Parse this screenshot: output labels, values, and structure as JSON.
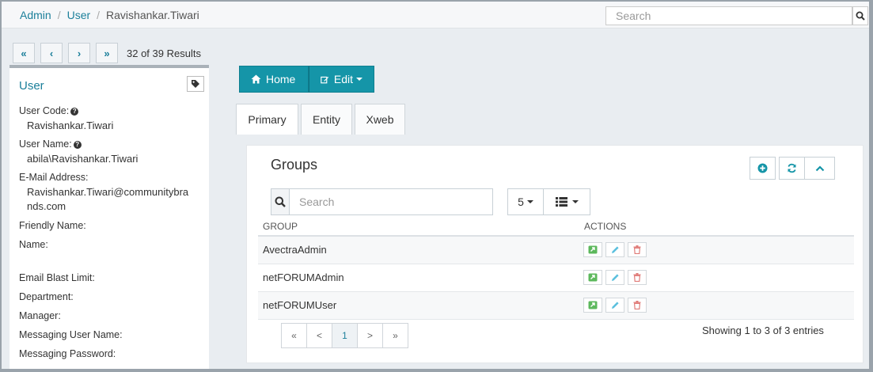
{
  "breadcrumb": [
    "Admin",
    "User",
    "Ravishankar.Tiwari"
  ],
  "top_search": {
    "placeholder": "Search"
  },
  "pager": {
    "first": "«",
    "prev": "‹",
    "next": "›",
    "last": "»",
    "results": "32 of 39 Results"
  },
  "sidebar": {
    "title": "User",
    "fields": {
      "user_code_label": "User Code:",
      "user_code_value": "Ravishankar.Tiwari",
      "user_name_label": "User Name:",
      "user_name_value": "abila\\Ravishankar.Tiwari",
      "email_label": "E-Mail Address:",
      "email_value_1": "Ravishankar.Tiwari@communitybra",
      "email_value_2": "nds.com",
      "friendly_name_label": "Friendly Name:",
      "name_label": "Name:",
      "email_blast_label": "Email Blast Limit:",
      "department_label": "Department:",
      "manager_label": "Manager:",
      "messaging_user_label": "Messaging User Name:",
      "messaging_password_label": "Messaging Password:"
    }
  },
  "toolbar": {
    "home_label": "Home",
    "edit_label": "Edit"
  },
  "tabs": [
    "Primary",
    "Entity",
    "Xweb"
  ],
  "groups_panel": {
    "title": "Groups",
    "search_placeholder": "Search",
    "page_size": "5",
    "columns": [
      "GROUP",
      "ACTIONS"
    ],
    "rows": [
      "AvectraAdmin",
      "netFORUMAdmin",
      "netFORUMUser"
    ],
    "pagination": [
      "«",
      "<",
      "1",
      ">",
      "»"
    ],
    "showing": "Showing 1 to 3 of 3 entries"
  },
  "icons": {
    "help": "question-circle-icon",
    "tag": "tag-icon",
    "home": "home-icon",
    "edit": "edit-icon",
    "add": "plus-circle-icon",
    "refresh": "refresh-icon",
    "collapse": "chevron-up-icon",
    "search": "search-icon",
    "columns": "list-icon",
    "goto": "external-link-icon",
    "pencil": "pencil-icon",
    "delete": "trash-icon"
  },
  "colors": {
    "accent": "#1595a8",
    "link": "#1b7f9a"
  }
}
